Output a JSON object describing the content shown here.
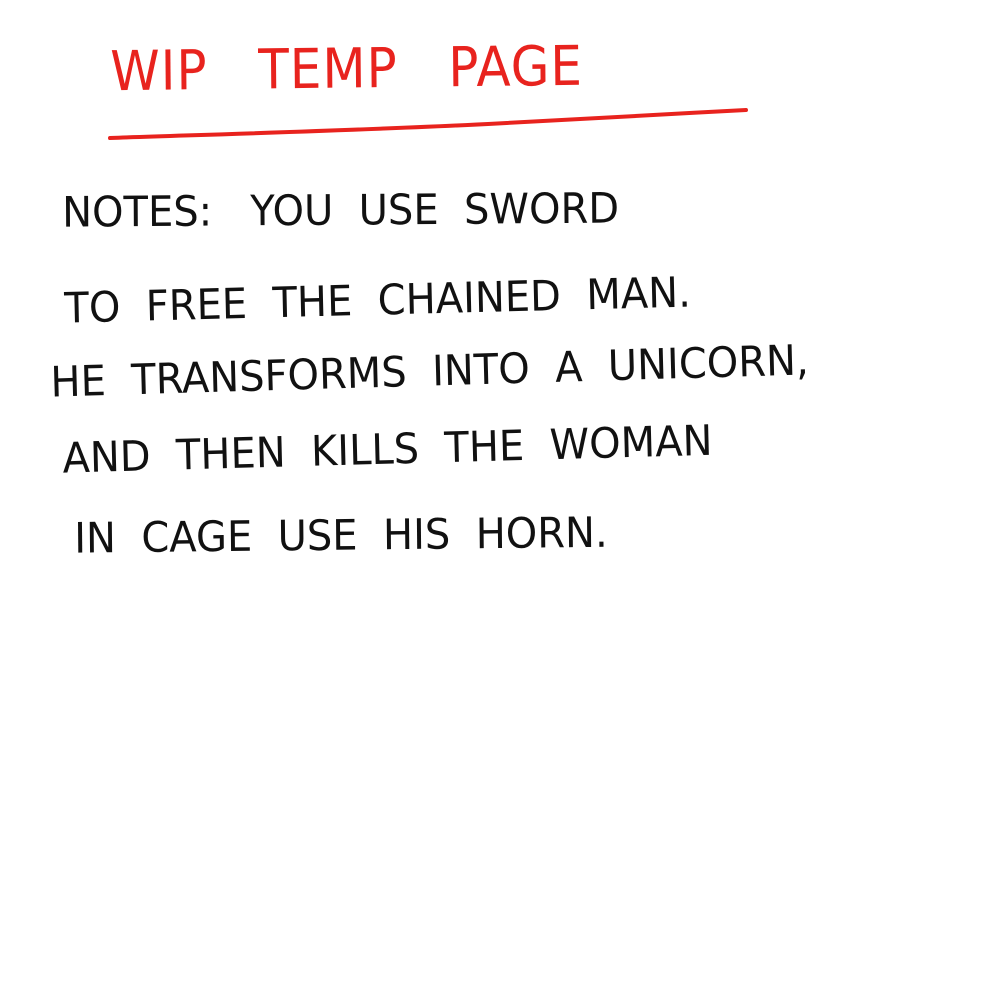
{
  "page": {
    "title": "WIP   TEMP   PAGE",
    "title_color": "#e8231e",
    "ink_color": "#111111",
    "notes_lines": [
      "NOTES:   YOU  USE  SWORD",
      "TO  FREE  THE  CHAINED  MAN.",
      "HE  TRANSFORMS  INTO  A  UNICORN,",
      "AND  THEN  KILLS  THE  WOMAN",
      "IN  CAGE  USE  HIS  HORN."
    ]
  }
}
